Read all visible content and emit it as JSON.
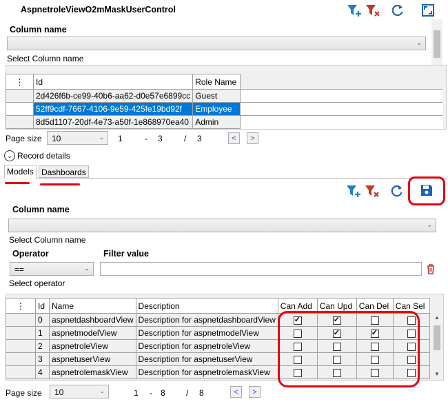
{
  "header": {
    "title": "AspnetroleViewO2mMaskUserControl"
  },
  "colors": {
    "accent": "#1f5fbf",
    "filter_add": "#1f7fd4",
    "filter_remove": "#c0392b",
    "selected": "#0078d7",
    "highlight": "#e8000d"
  },
  "top_filter": {
    "column_label": "Column name",
    "column_hint": "Select Column name"
  },
  "top_grid": {
    "menu_icon": "⋮",
    "columns": [
      "Id",
      "Role Name"
    ],
    "rows": [
      {
        "id": "2d426f6b-ce99-40b6-aa62-d0e57e6899cc",
        "role": "Guest"
      },
      {
        "id": "52ff9cdf-7667-4106-9e59-425fe19bd92f",
        "role": "Employee"
      },
      {
        "id": "8d5d1107-20df-4e73-a50f-1e868970ea40",
        "role": "Admin"
      }
    ]
  },
  "top_pager": {
    "label": "Page size",
    "size": "10",
    "from": "1",
    "dash": "-",
    "to": "3",
    "slash": "/",
    "total": "3",
    "prev": "<",
    "next": ">"
  },
  "record_details": {
    "label": "Record details"
  },
  "tabs": [
    {
      "label": "Models"
    },
    {
      "label": "Dashboards"
    }
  ],
  "detail_filter": {
    "column_label": "Column name",
    "column_hint": "Select Column name",
    "operator_label": "Operator",
    "operator_value": "==",
    "operator_hint": "Select operator",
    "filter_label": "Filter value",
    "filter_value": ""
  },
  "detail_grid": {
    "menu_icon": "⋮",
    "columns": [
      "Id",
      "Name",
      "Description",
      "Can Add",
      "Can Upd",
      "Can Del",
      "Can Sel"
    ],
    "rows": [
      {
        "id": "0",
        "name": "aspnetdashboardView",
        "desc": "Description for aspnetdashboardView",
        "add": true,
        "upd": true,
        "del": false,
        "sel": false
      },
      {
        "id": "1",
        "name": "aspnetmodelView",
        "desc": "Description for aspnetmodelView",
        "add": false,
        "upd": true,
        "del": true,
        "sel": false
      },
      {
        "id": "2",
        "name": "aspnetroleView",
        "desc": "Description for aspnetroleView",
        "add": false,
        "upd": false,
        "del": false,
        "sel": false
      },
      {
        "id": "3",
        "name": "aspnetuserView",
        "desc": "Description for aspnetuserView",
        "add": false,
        "upd": false,
        "del": false,
        "sel": false
      },
      {
        "id": "4",
        "name": "aspnetrolemaskView",
        "desc": "Description for aspnetrolemaskView",
        "add": false,
        "upd": false,
        "del": false,
        "sel": false
      }
    ]
  },
  "bottom_pager": {
    "label": "Page size",
    "size": "10",
    "from": "1",
    "dash": "-",
    "to": "8",
    "slash": "/",
    "total": "8",
    "prev": "<",
    "next": ">"
  }
}
